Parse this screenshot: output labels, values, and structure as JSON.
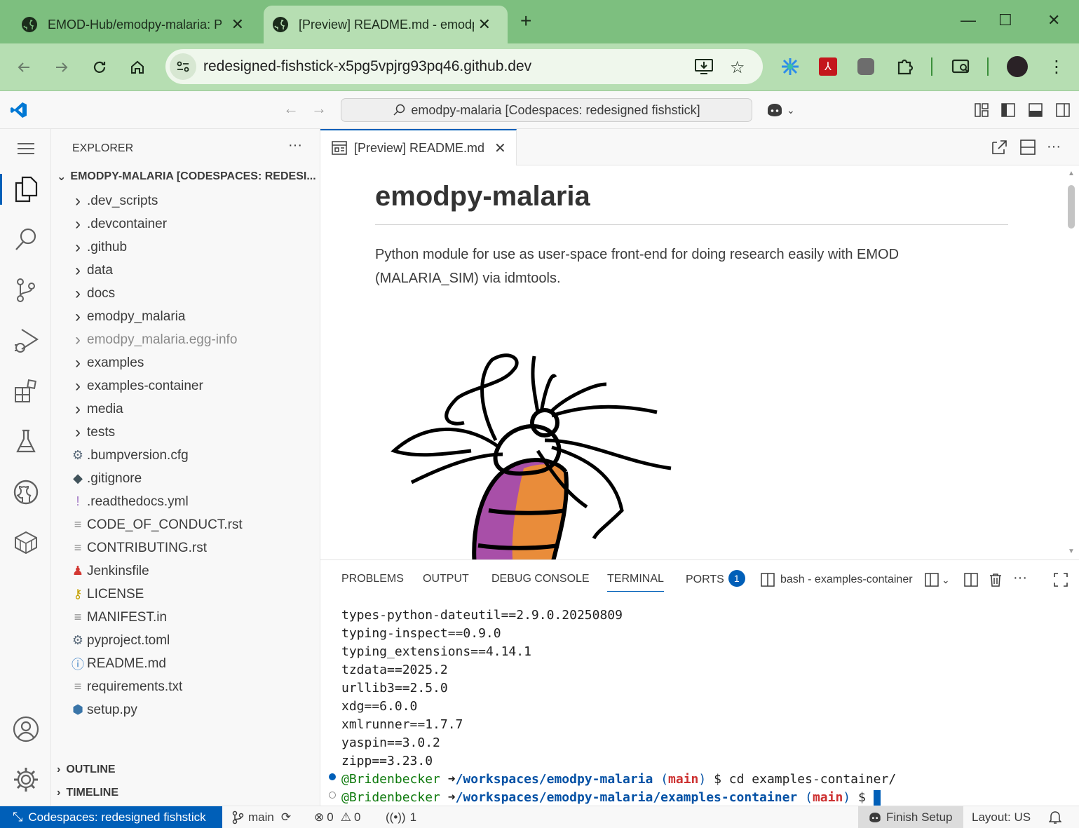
{
  "browser": {
    "tabs": [
      {
        "title": "EMOD-Hub/emodpy-malaria: P"
      },
      {
        "title": "[Preview] README.md - emodp"
      }
    ],
    "new_tab": "+",
    "url": "redesigned-fishstick-x5pg5vpjrg93pq46.github.dev"
  },
  "vscode": {
    "command_center": "emodpy-malaria [Codespaces: redesigned fishstick]",
    "explorer": {
      "title": "EXPLORER",
      "root": "EMODPY-MALARIA [CODESPACES: REDESI...",
      "items": [
        {
          "name": ".dev_scripts",
          "type": "folder"
        },
        {
          "name": ".devcontainer",
          "type": "folder"
        },
        {
          "name": ".github",
          "type": "folder"
        },
        {
          "name": "data",
          "type": "folder"
        },
        {
          "name": "docs",
          "type": "folder"
        },
        {
          "name": "emodpy_malaria",
          "type": "folder"
        },
        {
          "name": "emodpy_malaria.egg-info",
          "type": "folder"
        },
        {
          "name": "examples",
          "type": "folder"
        },
        {
          "name": "examples-container",
          "type": "folder"
        },
        {
          "name": "media",
          "type": "folder"
        },
        {
          "name": "tests",
          "type": "folder"
        },
        {
          "name": ".bumpversion.cfg",
          "type": "file"
        },
        {
          "name": ".gitignore",
          "type": "file"
        },
        {
          "name": ".readthedocs.yml",
          "type": "file"
        },
        {
          "name": "CODE_OF_CONDUCT.rst",
          "type": "file"
        },
        {
          "name": "CONTRIBUTING.rst",
          "type": "file"
        },
        {
          "name": "Jenkinsfile",
          "type": "file"
        },
        {
          "name": "LICENSE",
          "type": "file"
        },
        {
          "name": "MANIFEST.in",
          "type": "file"
        },
        {
          "name": "pyproject.toml",
          "type": "file"
        },
        {
          "name": "README.md",
          "type": "file"
        },
        {
          "name": "requirements.txt",
          "type": "file"
        },
        {
          "name": "setup.py",
          "type": "file"
        }
      ],
      "outline": "OUTLINE",
      "timeline": "TIMELINE"
    },
    "editor": {
      "tab_label": "[Preview] README.md",
      "heading": "emodpy-malaria",
      "paragraph": "Python module for use as user-space front-end for doing research easily with EMOD (MALARIA_SIM) via idmtools."
    },
    "panel": {
      "tabs": [
        "PROBLEMS",
        "OUTPUT",
        "DEBUG CONSOLE",
        "TERMINAL",
        "PORTS"
      ],
      "ports_count": "1",
      "terminal_name": "bash - examples-container",
      "lines": [
        "types-python-dateutil==2.9.0.20250809",
        "typing-inspect==0.9.0",
        "typing_extensions==4.14.1",
        "tzdata==2025.2",
        "urllib3==2.5.0",
        "xdg==6.0.0",
        "xmlrunner==1.7.7",
        "yaspin==3.0.2",
        "zipp==3.23.0"
      ],
      "prompt1": {
        "user": "@Bridenbecker",
        "arrow": "➜",
        "path": "/workspaces/emodpy-malaria",
        "branch_open": "(",
        "branch": "main",
        "branch_close": ")",
        "dollar": "$",
        "cmd": "cd examples-container/"
      },
      "prompt2": {
        "user": "@Bridenbecker",
        "arrow": "➜",
        "path": "/workspaces/emodpy-malaria/examples-container",
        "branch_open": "(",
        "branch": "main",
        "branch_close": ")",
        "dollar": "$"
      }
    },
    "status": {
      "remote": "Codespaces: redesigned fishstick",
      "branch": "main",
      "errors": "0",
      "warnings": "0",
      "ports": "1",
      "finish_setup": "Finish Setup",
      "layout": "Layout: US"
    }
  },
  "colors": {
    "accent": "#005fb8",
    "browser_frame": "#7dbf7f",
    "browser_toolbar": "#b6deb2"
  }
}
